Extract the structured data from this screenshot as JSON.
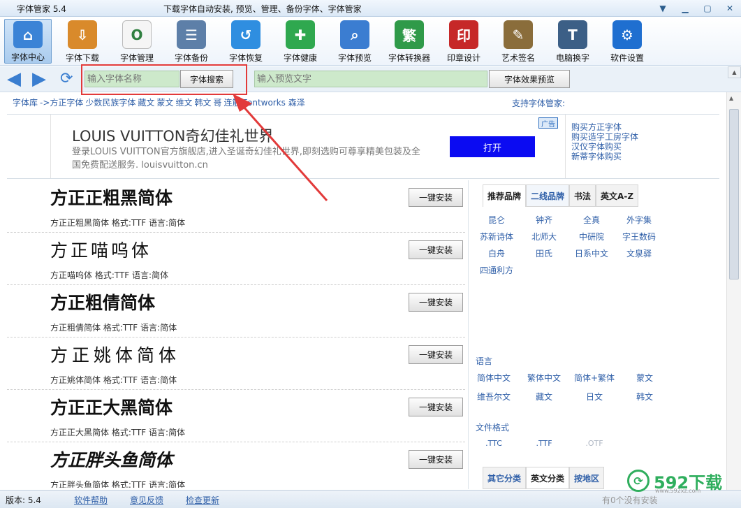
{
  "window": {
    "title": "字体管家 5.4",
    "tagline": "下载字体自动安装, 预览、管理、备份字体、字体管家",
    "controls": [
      "menu-icon",
      "minimize-icon",
      "maximize-icon",
      "close-icon"
    ]
  },
  "toolbar": [
    {
      "name": "font-center",
      "label": "字体中心",
      "icon": "house-icon",
      "color": "#3b83d6",
      "active": true
    },
    {
      "name": "font-download",
      "label": "字体下载",
      "icon": "download-box-icon",
      "color": "#d98a2b"
    },
    {
      "name": "font-manage",
      "label": "字体管理",
      "icon": "font-file-icon",
      "color": "#f5f5f5"
    },
    {
      "name": "font-backup",
      "label": "字体备份",
      "icon": "document-icon",
      "color": "#5d7fa8"
    },
    {
      "name": "font-restore",
      "label": "字体恢复",
      "icon": "restore-icon",
      "color": "#2f8ee0"
    },
    {
      "name": "font-health",
      "label": "字体健康",
      "icon": "medical-kit-icon",
      "color": "#2fa84f"
    },
    {
      "name": "font-preview",
      "label": "字体预览",
      "icon": "magnifier-icon",
      "color": "#3b7dd1"
    },
    {
      "name": "font-converter",
      "label": "字体转换器",
      "icon": "converter-icon",
      "color": "#2f9a49"
    },
    {
      "name": "seal-design",
      "label": "印章设计",
      "icon": "seal-icon",
      "color": "#c62828"
    },
    {
      "name": "art-signature",
      "label": "艺术签名",
      "icon": "signature-icon",
      "color": "#8a6d3b"
    },
    {
      "name": "pc-font-swap",
      "label": "电脑换字",
      "icon": "monitor-icon",
      "color": "#3c5f86"
    },
    {
      "name": "software-settings",
      "label": "软件设置",
      "icon": "gear-icon",
      "color": "#1f6fd0"
    }
  ],
  "search": {
    "font_placeholder": "输入字体名称",
    "search_button": "字体搜索",
    "preview_placeholder": "输入预览文字",
    "preview_button": "字体效果预览"
  },
  "breadcrumb": [
    "字体库",
    "->方正字体",
    "少数民族字体",
    "藏文",
    "蒙文",
    "维文",
    "韩文",
    "哥",
    "连筋",
    "Fontworks 森泽"
  ],
  "support_text": "支持字体管家:",
  "ad": {
    "title": "LOUIS VUITTON奇幻佳礼世界",
    "body": "登录LOUIS VUITTON官方旗舰店,进入圣诞奇幻佳礼世界,即刻选购可尊享精美包装及全国免费配送服务. louisvuitton.cn",
    "open_button": "打开",
    "tag": "广告",
    "links": [
      "购买方正字体",
      "购买造字工房字体",
      "汉仪字体购买",
      "新蒂字体购买"
    ]
  },
  "fonts": [
    {
      "name": "方正正粗黑简体",
      "meta": "方正正粗黑简体  格式:TTF 语言:简体",
      "install": "一键安装"
    },
    {
      "name": "方正喵呜体",
      "meta": "方正喵呜体  格式:TTF 语言:简体",
      "install": "一键安装"
    },
    {
      "name": "方正粗倩简体",
      "meta": "方正粗倩简体  格式:TTF 语言:简体",
      "install": "一键安装"
    },
    {
      "name": "方正姚体简体",
      "meta": "方正姚体简体  格式:TTF 语言:简体",
      "install": "一键安装"
    },
    {
      "name": "方正正大黑简体",
      "meta": "方正正大黑简体  格式:TTF 语言:简体",
      "install": "一键安装"
    },
    {
      "name": "方正胖头鱼简体",
      "meta": "方正胖头鱼简体  格式:TTF 语言:简体",
      "install": "一键安装"
    }
  ],
  "side": {
    "tabs": [
      "推荐品牌",
      "二线品牌",
      "书法",
      "英文A-Z"
    ],
    "brands": [
      "昆仑",
      "钟齐",
      "全真",
      "外字集",
      "苏新诗体",
      "北师大",
      "中研院",
      "字王数码",
      "白舟",
      "田氏",
      "日系中文",
      "文泉驿",
      "四通利方"
    ],
    "language_label": "语言",
    "languages": [
      "简体中文",
      "繁体中文",
      "简体+繁体",
      "蒙文",
      "维吾尔文",
      "藏文",
      "日文",
      "韩文"
    ],
    "format_label": "文件格式",
    "formats": [
      ".TTC",
      ".TTF",
      ".OTF"
    ],
    "bottom_tabs": [
      "其它分类",
      "英文分类",
      "按地区"
    ]
  },
  "status": {
    "version": "版本: 5.4",
    "help": "软件帮助",
    "feedback": "意见反馈",
    "update": "检查更新",
    "right_text": "有0个没有安装"
  },
  "watermark": {
    "text": "592下载",
    "url": "www.592xz.com"
  }
}
